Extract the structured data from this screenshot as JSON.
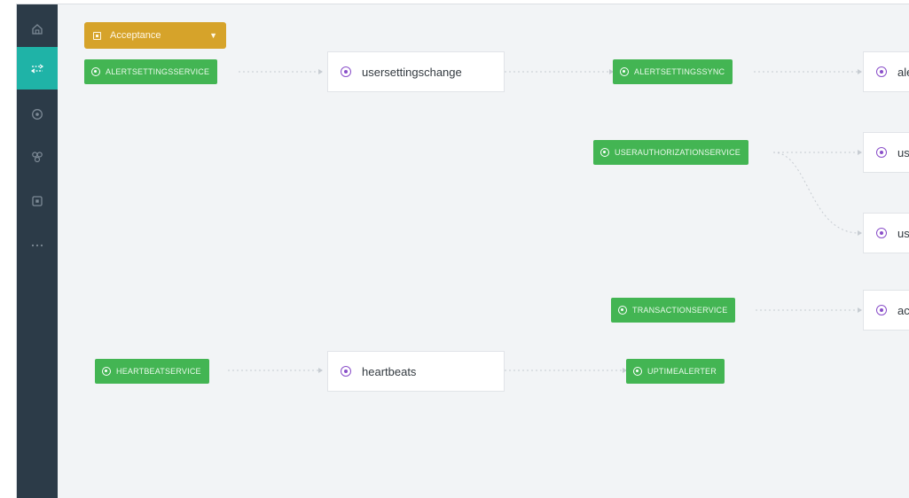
{
  "environment": {
    "label": "Acceptance"
  },
  "sidebar": {
    "items": [
      {
        "icon": "home-icon"
      },
      {
        "icon": "flow-icon",
        "active": true
      },
      {
        "icon": "target-icon"
      },
      {
        "icon": "cluster-icon"
      },
      {
        "icon": "box-icon"
      },
      {
        "icon": "more-icon"
      }
    ]
  },
  "services": {
    "alertsettingsservice": "ALERTSETTINGSSERVICE",
    "alertsettingssync": "ALERTSETTINGSSYNC",
    "userauthorizationservice": "USERAUTHORIZATIONSERVICE",
    "transactionservice": "TRANSACTIONSERVICE",
    "heartbeatservice": "HEARTBEATSERVICE",
    "uptimealerter": "UPTIMEALERTER"
  },
  "topics": {
    "usersettingschange": "usersettingschange",
    "alert_partial": "ale",
    "user_partial_1": "use",
    "user_partial_2": "use",
    "acc_partial": "acc",
    "heartbeats": "heartbeats"
  },
  "colors": {
    "sidebar": "#2c3b48",
    "sidebar_active": "#1fb3a7",
    "service": "#43b553",
    "environment": "#d6a32a",
    "topic_dot": "#8a4fc9",
    "canvas": "#f2f4f6"
  }
}
